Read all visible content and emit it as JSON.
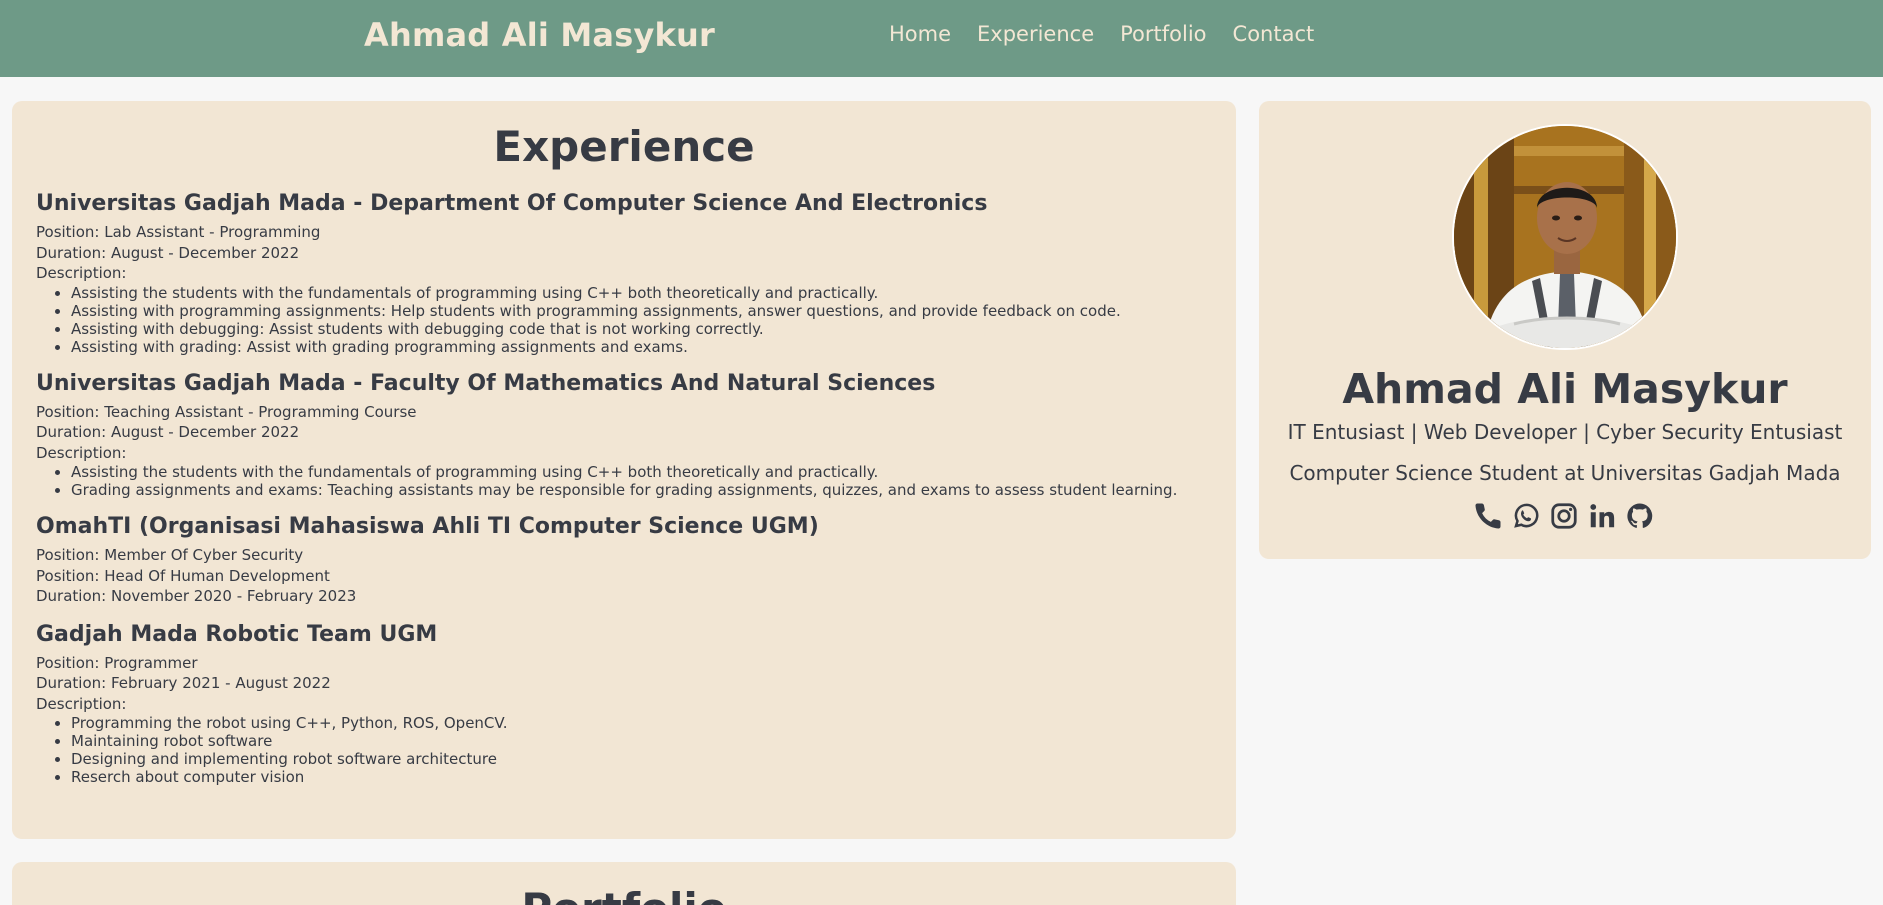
{
  "navbar": {
    "brand": "Ahmad Ali Masykur",
    "links": [
      {
        "label": "Home"
      },
      {
        "label": "Experience"
      },
      {
        "label": "Portfolio"
      },
      {
        "label": "Contact"
      }
    ]
  },
  "experience": {
    "title": "Experience",
    "items": [
      {
        "org": "Universitas Gadjah Mada - Department Of Computer Science And Electronics",
        "lines": [
          "Position: Lab Assistant - Programming",
          "Duration: August - December 2022",
          "Description:"
        ],
        "bullets": [
          "Assisting the students with the fundamentals of programming using C++ both theoretically and practically.",
          "Assisting with programming assignments: Help students with programming assignments, answer questions, and provide feedback on code.",
          "Assisting with debugging: Assist students with debugging code that is not working correctly.",
          "Assisting with grading: Assist with grading programming assignments and exams."
        ]
      },
      {
        "org": "Universitas Gadjah Mada - Faculty Of Mathematics And Natural Sciences",
        "lines": [
          "Position: Teaching Assistant - Programming Course",
          "Duration: August - December 2022",
          "Description:"
        ],
        "bullets": [
          "Assisting the students with the fundamentals of programming using C++ both theoretically and practically.",
          "Grading assignments and exams: Teaching assistants may be responsible for grading assignments, quizzes, and exams to assess student learning."
        ]
      },
      {
        "org": "OmahTI (Organisasi Mahasiswa Ahli TI Computer Science UGM)",
        "lines": [
          "Position: Member Of Cyber Security",
          "Position: Head Of Human Development",
          "Duration: November 2020 - February 2023"
        ],
        "bullets": []
      },
      {
        "org": "Gadjah Mada Robotic Team UGM",
        "lines": [
          "Position: Programmer",
          "Duration: February 2021 - August 2022",
          "Description:"
        ],
        "bullets": [
          "Programming the robot using C++, Python, ROS, OpenCV.",
          "Maintaining robot software",
          "Designing and implementing robot software architecture",
          "Reserch about computer vision"
        ]
      }
    ]
  },
  "profile": {
    "name": "Ahmad Ali Masykur",
    "tagline": "IT Entusiast | Web Developer | Cyber Security Entusiast",
    "study": "Computer Science Student at Universitas Gadjah Mada",
    "socials": [
      {
        "icon": "phone-icon"
      },
      {
        "icon": "whatsapp-icon"
      },
      {
        "icon": "instagram-icon"
      },
      {
        "icon": "linkedin-icon"
      },
      {
        "icon": "github-icon"
      }
    ]
  },
  "portfolio": {
    "title": "Portfolio"
  },
  "colors": {
    "navbar": "#6e9a87",
    "card": "#f2e6d4",
    "text": "#373b44",
    "nav_text": "#f3e7d4"
  }
}
